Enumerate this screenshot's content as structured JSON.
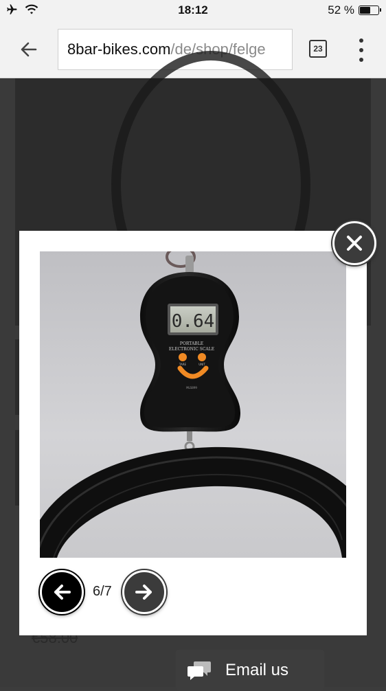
{
  "status_bar": {
    "time": "18:12",
    "battery": "52 %",
    "battery_level": 0.52,
    "icons": [
      "airplane-mode-icon",
      "wifi-icon",
      "battery-icon"
    ]
  },
  "browser": {
    "url_domain": "8bar-bikes.com",
    "url_path": "/de/shop/felge",
    "tab_count": "23"
  },
  "page": {
    "price": "€58.00"
  },
  "lightbox": {
    "counter": "6/7",
    "scale_display": "0.64",
    "scale_brand_line1": "PORTABLE",
    "scale_brand_line2": "ELECTRONIC SCALE",
    "scale_btn_left": "TARE",
    "scale_btn_right": "UNIT",
    "scale_model": "MLS899"
  },
  "email_widget": {
    "label": "Email us"
  },
  "colors": {
    "overlay_bg": "#3c3c3c",
    "lightbox_bg": "#ffffff",
    "scale_accent": "#f08a24",
    "nav_prev": "#000000",
    "nav_next": "#3b3b3b"
  }
}
